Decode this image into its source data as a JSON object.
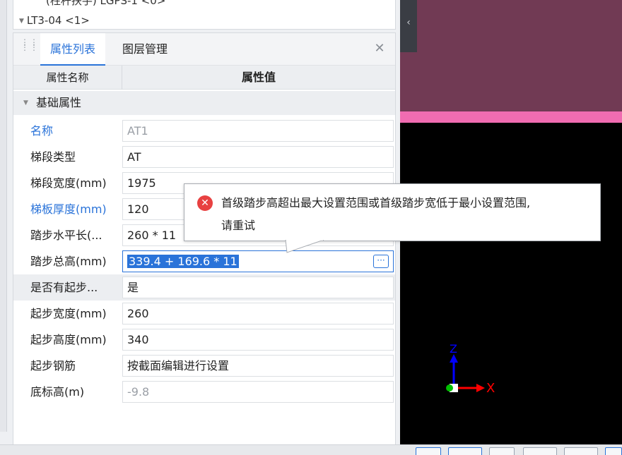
{
  "tree": {
    "item1": "(柱杆扶手) LGPS-1 <0>",
    "item2": "LT3-04 <1>"
  },
  "tabs": [
    {
      "label": "属性列表",
      "active": true
    },
    {
      "label": "图层管理",
      "active": false
    }
  ],
  "close_glyph": "✕",
  "table": {
    "col_name": "属性名称",
    "col_value": "属性值",
    "group": "基础属性"
  },
  "properties": [
    {
      "name": "名称",
      "value": "AT1",
      "name_color": "blue",
      "value_gray": true
    },
    {
      "name": "梯段类型",
      "value": "AT"
    },
    {
      "name": "梯段宽度(mm)",
      "value": "1975"
    },
    {
      "name": "梯板厚度(mm)",
      "value": "120",
      "name_color": "blue"
    },
    {
      "name": "踏步水平长(...",
      "value": "260 * 11"
    },
    {
      "name": "踏步总高(mm)",
      "value": "339.4 + 169.6 * 11",
      "editing": true
    },
    {
      "name": "是否有起步...",
      "value": "是"
    },
    {
      "name": "起步宽度(mm)",
      "value": "260"
    },
    {
      "name": "起步高度(mm)",
      "value": "340"
    },
    {
      "name": "起步钢筋",
      "value": "按截面编辑进行设置"
    },
    {
      "name": "底标高(m)",
      "value": "-9.8",
      "value_gray": true
    }
  ],
  "tooltip": {
    "line1": "首级踏步高超出最大设置范围或首级踏步宽低于最小设置范围,",
    "line2": "请重试",
    "icon": "error-icon"
  },
  "ellipsis_label": "···",
  "axes": {
    "z": "Z",
    "x": "X"
  },
  "colors": {
    "accent": "#2a73d9",
    "error": "#e84141",
    "viewport_plane": "#713a54",
    "viewport_edge": "#f06cb1",
    "axis_x": "#ff0000",
    "axis_z": "#0000ff"
  }
}
